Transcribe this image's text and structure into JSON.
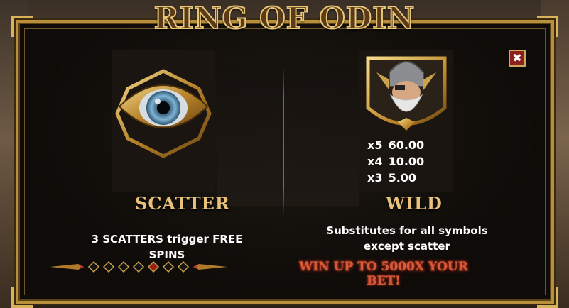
{
  "title": "RING OF ODIN",
  "close_label": "✖",
  "scatter": {
    "name": "SCATTER",
    "description": "3 SCATTERS trigger FREE SPINS"
  },
  "wild": {
    "name": "WILD",
    "payouts": [
      {
        "mult": "x5",
        "value": "60.00"
      },
      {
        "mult": "x4",
        "value": "10.00"
      },
      {
        "mult": "x3",
        "value": "5.00"
      }
    ],
    "description": "Substitutes for all symbols except scatter",
    "bonus_text": "WIN UP TO 5000X YOUR BET!"
  },
  "pager": {
    "total": 7,
    "active": 4
  }
}
